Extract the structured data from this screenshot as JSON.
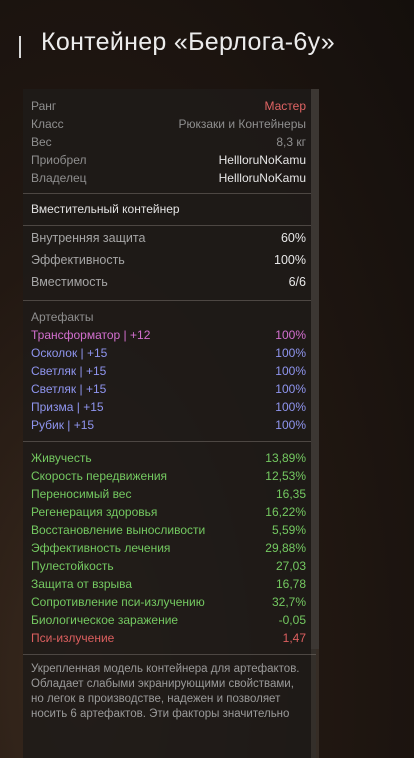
{
  "title": "Контейнер «Берлога-6у»",
  "colors": {
    "rank": "#e06464",
    "artifact_pink": "#d36fcf",
    "artifact_blue": "#8f95ef",
    "stat_green": "#74c961",
    "stat_red": "#dc5f5f"
  },
  "info": [
    {
      "label": "Ранг",
      "value": "Мастер",
      "value_color": "rank"
    },
    {
      "label": "Класс",
      "value": "Рюкзаки и Контейнеры",
      "value_color": "gray"
    },
    {
      "label": "Вес",
      "value": "8,3 кг",
      "value_color": "gray"
    },
    {
      "label": "Приобрел",
      "value": "HellloruNoKamu",
      "value_color": "white"
    },
    {
      "label": "Владелец",
      "value": "HellloruNoKamu",
      "value_color": "white"
    }
  ],
  "container_type": "Вместительный контейнер",
  "properties": [
    {
      "label": "Внутренняя защита",
      "value": "60%"
    },
    {
      "label": "Эффективность",
      "value": "100%"
    },
    {
      "label": "Вместимость",
      "value": "6/6"
    }
  ],
  "artifacts_title": "Артефакты",
  "artifacts": [
    {
      "name": "Трансформатор | +12",
      "value": "100%",
      "color": "artifact_pink"
    },
    {
      "name": "Осколок | +15",
      "value": "100%",
      "color": "artifact_blue"
    },
    {
      "name": "Светляк | +15",
      "value": "100%",
      "color": "artifact_blue"
    },
    {
      "name": "Светляк | +15",
      "value": "100%",
      "color": "artifact_blue"
    },
    {
      "name": "Призма | +15",
      "value": "100%",
      "color": "artifact_blue"
    },
    {
      "name": "Рубик | +15",
      "value": "100%",
      "color": "artifact_blue"
    }
  ],
  "stats": [
    {
      "label": "Живучесть",
      "value": "13,89%",
      "color": "stat_green"
    },
    {
      "label": "Скорость передвижения",
      "value": "12,53%",
      "color": "stat_green"
    },
    {
      "label": "Переносимый вес",
      "value": "16,35",
      "color": "stat_green"
    },
    {
      "label": "Регенерация здоровья",
      "value": "16,22%",
      "color": "stat_green"
    },
    {
      "label": "Восстановление выносливости",
      "value": "5,59%",
      "color": "stat_green"
    },
    {
      "label": "Эффективность лечения",
      "value": "29,88%",
      "color": "stat_green"
    },
    {
      "label": "Пулестойкость",
      "value": "27,03",
      "color": "stat_green"
    },
    {
      "label": "Защита от взрыва",
      "value": "16,78",
      "color": "stat_green"
    },
    {
      "label": "Сопротивление пси-излучению",
      "value": "32,7%",
      "color": "stat_green"
    },
    {
      "label": "Биологическое заражение",
      "value": "-0,05",
      "color": "stat_green"
    },
    {
      "label": "Пси-излучение",
      "value": "1,47",
      "color": "stat_red"
    }
  ],
  "description": "Укрепленная модель контейнера для артефактов. Обладает слабыми экранирующими свойствами, но легок в производстве, надежен и позволяет носить 6 артефактов. Эти факторы значительно"
}
